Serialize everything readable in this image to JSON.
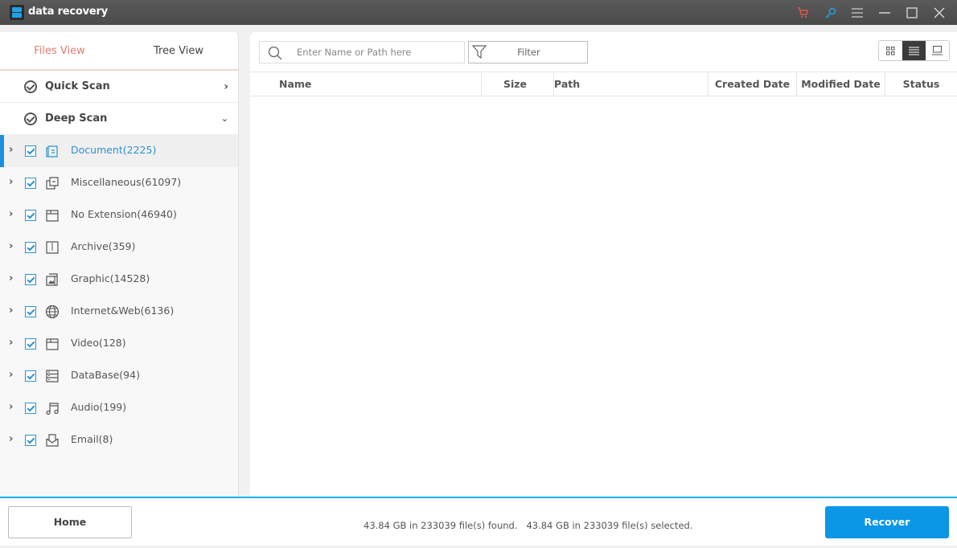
{
  "app": {
    "title": "data recovery",
    "brand_color": "#1fa1e8",
    "titlebar_icons": [
      "cart-icon",
      "key-icon",
      "menu-icon",
      "minimize-icon",
      "maximize-icon",
      "close-icon"
    ]
  },
  "sidebar": {
    "tabs": [
      {
        "label": "Files View",
        "active": true
      },
      {
        "label": "Tree View",
        "active": false
      }
    ],
    "scans": [
      {
        "label": "Quick Scan",
        "expanded": false
      },
      {
        "label": "Deep Scan",
        "expanded": true
      }
    ],
    "categories": [
      {
        "label": "Document(2225)",
        "icon": "document-icon",
        "checked": true,
        "selected": true
      },
      {
        "label": "Miscellaneous(61097)",
        "icon": "miscellaneous-icon",
        "checked": true,
        "selected": false
      },
      {
        "label": "No Extension(46940)",
        "icon": "folder-icon",
        "checked": true,
        "selected": false
      },
      {
        "label": "Archive(359)",
        "icon": "archive-icon",
        "checked": true,
        "selected": false
      },
      {
        "label": "Graphic(14528)",
        "icon": "graphic-icon",
        "checked": true,
        "selected": false
      },
      {
        "label": "Internet&Web(6136)",
        "icon": "globe-icon",
        "checked": true,
        "selected": false
      },
      {
        "label": "Video(128)",
        "icon": "video-folder-icon",
        "checked": true,
        "selected": false
      },
      {
        "label": "DataBase(94)",
        "icon": "database-icon",
        "checked": true,
        "selected": false
      },
      {
        "label": "Audio(199)",
        "icon": "music-note-icon",
        "checked": true,
        "selected": false
      },
      {
        "label": "Email(8)",
        "icon": "email-icon",
        "checked": true,
        "selected": false
      }
    ]
  },
  "toolbar": {
    "search_placeholder": "Enter Name or Path here",
    "search_value": "",
    "filter_label": "Filter",
    "view_modes": [
      "grid-view",
      "list-view",
      "preview-view"
    ],
    "active_view": "list-view"
  },
  "table": {
    "columns": [
      "Name",
      "Size",
      "Path",
      "Created Date",
      "Modified Date",
      "Status"
    ],
    "rows": []
  },
  "footer": {
    "home_label": "Home",
    "status_found": "43.84 GB in 233039 file(s) found.",
    "status_selected": "43.84 GB in 233039 file(s) selected.",
    "recover_label": "Recover",
    "accent_color": "#0b96e6"
  }
}
